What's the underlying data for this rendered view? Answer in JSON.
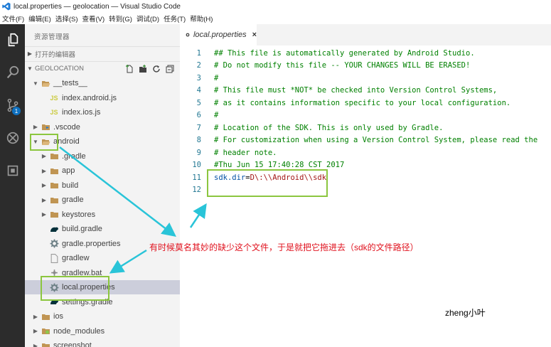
{
  "window": {
    "title": "local.properties — geolocation — Visual Studio Code"
  },
  "menu": {
    "items": [
      "文件(F)",
      "编辑(E)",
      "选择(S)",
      "查看(V)",
      "转到(G)",
      "调试(D)",
      "任务(T)",
      "帮助(H)"
    ]
  },
  "activity": {
    "scm_badge": "1",
    "icons": [
      "files-icon",
      "search-icon",
      "source-control-icon",
      "debug-icon",
      "extensions-icon"
    ]
  },
  "sidebar": {
    "title": "资源管理器",
    "open_editors_label": "打开的编辑器",
    "project_label": "GEOLOCATION",
    "tree": [
      {
        "label": "__tests__",
        "kind": "folder-open",
        "indent": 1
      },
      {
        "label": "index.android.js",
        "kind": "js",
        "indent": 2
      },
      {
        "label": "index.ios.js",
        "kind": "js",
        "indent": 2
      },
      {
        "label": ".vscode",
        "kind": "vscode",
        "indent": 1
      },
      {
        "label": "android",
        "kind": "folder-open",
        "indent": 1
      },
      {
        "label": ".gradle",
        "kind": "folder",
        "indent": 2
      },
      {
        "label": "app",
        "kind": "folder",
        "indent": 2
      },
      {
        "label": "build",
        "kind": "folder",
        "indent": 2
      },
      {
        "label": "gradle",
        "kind": "folder",
        "indent": 2
      },
      {
        "label": "keystores",
        "kind": "folder",
        "indent": 2
      },
      {
        "label": "build.gradle",
        "kind": "gradle",
        "indent": 2
      },
      {
        "label": "gradle.properties",
        "kind": "gear",
        "indent": 2
      },
      {
        "label": "gradlew",
        "kind": "file",
        "indent": 2
      },
      {
        "label": "gradlew.bat",
        "kind": "bat",
        "indent": 2
      },
      {
        "label": "local.properties",
        "kind": "gear",
        "indent": 2,
        "selected": true
      },
      {
        "label": "settings.gradle",
        "kind": "gradle",
        "indent": 2
      },
      {
        "label": "ios",
        "kind": "folder",
        "indent": 1
      },
      {
        "label": "node_modules",
        "kind": "node",
        "indent": 1
      },
      {
        "label": "screenshot",
        "kind": "folder",
        "indent": 1
      }
    ]
  },
  "editor": {
    "tab_label": "local.properties",
    "tab_close": "×",
    "lines": [
      {
        "n": "1",
        "text": "## This file is automatically generated by Android Studio."
      },
      {
        "n": "2",
        "text": "# Do not modify this file -- YOUR CHANGES WILL BE ERASED!"
      },
      {
        "n": "3",
        "text": "#"
      },
      {
        "n": "4",
        "text": "# This file must *NOT* be checked into Version Control Systems,"
      },
      {
        "n": "5",
        "text": "# as it contains information specific to your local configuration."
      },
      {
        "n": "6",
        "text": "#"
      },
      {
        "n": "7",
        "text": "# Location of the SDK. This is only used by Gradle."
      },
      {
        "n": "8",
        "text": "# For customization when using a Version Control System, please read the"
      },
      {
        "n": "9",
        "text": "# header note."
      },
      {
        "n": "10",
        "text": "#Thu Jun 15 17:40:28 CST 2017"
      },
      {
        "n": "11",
        "key": "sdk.dir",
        "eq": "=",
        "value": "D\\:\\\\Android\\\\sdk"
      },
      {
        "n": "12",
        "text": ""
      }
    ]
  },
  "annotation": {
    "text": "有时候莫名其妙的缺少这个文件，于是就把它拖进去（sdk的文件路径）",
    "watermark": "zheng小叶"
  },
  "colors": {
    "activity_bar": "#2c2c2c",
    "sidebar": "#f3f3f3",
    "selection": "#cccedb",
    "highlight_box": "#8cc63f",
    "arrow": "#29c4d8",
    "annotation": "#e0121e",
    "comment": "#008000"
  }
}
